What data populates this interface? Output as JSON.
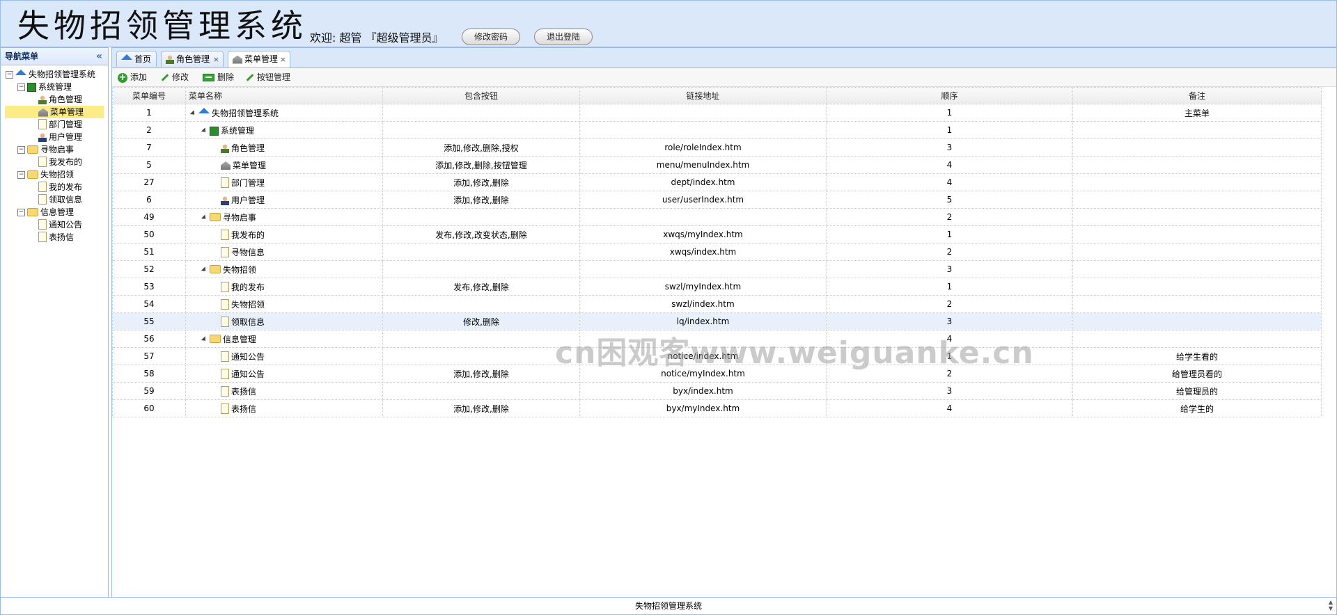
{
  "header": {
    "title": "失物招领管理系统",
    "welcome": "欢迎: 超管 『超级管理员』",
    "change_password": "修改密码",
    "logout": "退出登陆"
  },
  "nav": {
    "title": "导航菜单",
    "tree": [
      {
        "label": "失物招领管理系统",
        "icon": "home-icon"
      },
      {
        "label": "系统管理",
        "icon": "system-icon"
      },
      {
        "label": "角色管理",
        "icon": "user-icon"
      },
      {
        "label": "菜单管理",
        "icon": "menu-icon"
      },
      {
        "label": "部门管理",
        "icon": "file-icon"
      },
      {
        "label": "用户管理",
        "icon": "user-icon"
      },
      {
        "label": "寻物启事",
        "icon": "folder-icon"
      },
      {
        "label": "我发布的",
        "icon": "file-icon"
      },
      {
        "label": "失物招领",
        "icon": "folder-icon"
      },
      {
        "label": "我的发布",
        "icon": "file-icon"
      },
      {
        "label": "领取信息",
        "icon": "file-icon"
      },
      {
        "label": "信息管理",
        "icon": "folder-icon"
      },
      {
        "label": "通知公告",
        "icon": "file-icon"
      },
      {
        "label": "表扬信",
        "icon": "file-icon"
      }
    ]
  },
  "tabs": [
    {
      "label": "首页"
    },
    {
      "label": "角色管理"
    },
    {
      "label": "菜单管理"
    }
  ],
  "toolbar": {
    "add": "添加",
    "edit": "修改",
    "delete": "删除",
    "button_manage": "按钮管理"
  },
  "grid": {
    "columns": [
      "菜单编号",
      "菜单名称",
      "包含按钮",
      "链接地址",
      "顺序",
      "备注"
    ],
    "rows": [
      {
        "id": "1",
        "name": "失物招领管理系统",
        "buttons": "",
        "url": "",
        "order": "1",
        "remark": "主菜单"
      },
      {
        "id": "2",
        "name": "系统管理",
        "buttons": "",
        "url": "",
        "order": "1",
        "remark": ""
      },
      {
        "id": "7",
        "name": "角色管理",
        "buttons": "添加,修改,删除,授权",
        "url": "role/roleIndex.htm",
        "order": "3",
        "remark": ""
      },
      {
        "id": "5",
        "name": "菜单管理",
        "buttons": "添加,修改,删除,按钮管理",
        "url": "menu/menuIndex.htm",
        "order": "4",
        "remark": ""
      },
      {
        "id": "27",
        "name": "部门管理",
        "buttons": "添加,修改,删除",
        "url": "dept/index.htm",
        "order": "4",
        "remark": ""
      },
      {
        "id": "6",
        "name": "用户管理",
        "buttons": "添加,修改,删除",
        "url": "user/userIndex.htm",
        "order": "5",
        "remark": ""
      },
      {
        "id": "49",
        "name": "寻物启事",
        "buttons": "",
        "url": "",
        "order": "2",
        "remark": ""
      },
      {
        "id": "50",
        "name": "我发布的",
        "buttons": "发布,修改,改变状态,删除",
        "url": "xwqs/myIndex.htm",
        "order": "1",
        "remark": ""
      },
      {
        "id": "51",
        "name": "寻物信息",
        "buttons": "",
        "url": "xwqs/index.htm",
        "order": "2",
        "remark": ""
      },
      {
        "id": "52",
        "name": "失物招领",
        "buttons": "",
        "url": "",
        "order": "3",
        "remark": ""
      },
      {
        "id": "53",
        "name": "我的发布",
        "buttons": "发布,修改,删除",
        "url": "swzl/myIndex.htm",
        "order": "1",
        "remark": ""
      },
      {
        "id": "54",
        "name": "失物招领",
        "buttons": "",
        "url": "swzl/index.htm",
        "order": "2",
        "remark": ""
      },
      {
        "id": "55",
        "name": "领取信息",
        "buttons": "修改,删除",
        "url": "lq/index.htm",
        "order": "3",
        "remark": ""
      },
      {
        "id": "56",
        "name": "信息管理",
        "buttons": "",
        "url": "",
        "order": "4",
        "remark": ""
      },
      {
        "id": "57",
        "name": "通知公告",
        "buttons": "",
        "url": "notice/index.htm",
        "order": "1",
        "remark": "给学生看的"
      },
      {
        "id": "58",
        "name": "通知公告",
        "buttons": "添加,修改,删除",
        "url": "notice/myIndex.htm",
        "order": "2",
        "remark": "给管理员看的"
      },
      {
        "id": "59",
        "name": "表扬信",
        "buttons": "",
        "url": "byx/index.htm",
        "order": "3",
        "remark": "给管理员的"
      },
      {
        "id": "60",
        "name": "表扬信",
        "buttons": "添加,修改,删除",
        "url": "byx/myIndex.htm",
        "order": "4",
        "remark": "给学生的"
      }
    ]
  },
  "footer": {
    "text": "失物招领管理系统"
  },
  "watermark": "cn困观客www.weiguanke.cn"
}
